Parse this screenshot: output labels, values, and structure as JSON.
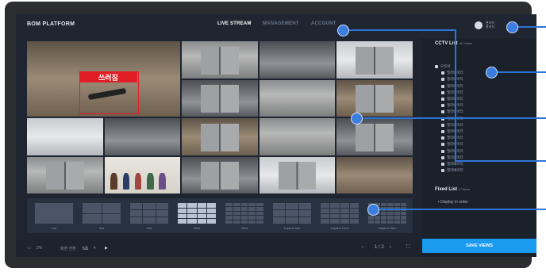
{
  "header": {
    "logo": "BOM PLATFORM",
    "nav": [
      {
        "label": "LIVE STREAM",
        "active": true
      },
      {
        "label": "MANAGEMENT",
        "active": false
      },
      {
        "label": "ACCOUNT",
        "active": false
      }
    ],
    "user_line1": "관리자",
    "user_line2": "관리자"
  },
  "alert_label": "쓰러짐",
  "cctv_list": {
    "title": "CCTV List",
    "subtitle": "All Views",
    "root": "오토비",
    "items": [
      "엘리베이터",
      "엘리베이터",
      "엘리베이터",
      "엘리베이터",
      "엘리베이터",
      "엘리베이터",
      "엘리베이터",
      "엘리베이터",
      "엘리베이터",
      "엘리베이터",
      "엘리베이터",
      "엘리베이터",
      "엘리베이터",
      "엘리베이터",
      "엘리베이터",
      "엘리베이터"
    ]
  },
  "fixed_list": {
    "title": "Fixed List",
    "subtitle": "3 Views",
    "item": "Display in order"
  },
  "layouts": [
    {
      "label": "1ch",
      "cols": 1,
      "rows": 1
    },
    {
      "label": "4ch",
      "cols": 2,
      "rows": 2
    },
    {
      "label": "9ch",
      "cols": 3,
      "rows": 3
    },
    {
      "label": "16ch",
      "cols": 4,
      "rows": 4,
      "selected": true
    },
    {
      "label": "25ch",
      "cols": 5,
      "rows": 5
    },
    {
      "label": "expand 6ch",
      "cols": 3,
      "rows": 3
    },
    {
      "label": "expand 12ch",
      "cols": 4,
      "rows": 4
    },
    {
      "label": "expand 28ch",
      "cols": 6,
      "rows": 5
    }
  ],
  "bottom": {
    "screen_label": "2%",
    "rotation_label": "화면 전환",
    "rotation_value": "5초",
    "page": "1 / 2"
  },
  "save_button": "SAVE VIEWS",
  "colors": {
    "accent": "#1a9bf0",
    "alert": "#e11e25",
    "callout": "#3b7ee0"
  }
}
